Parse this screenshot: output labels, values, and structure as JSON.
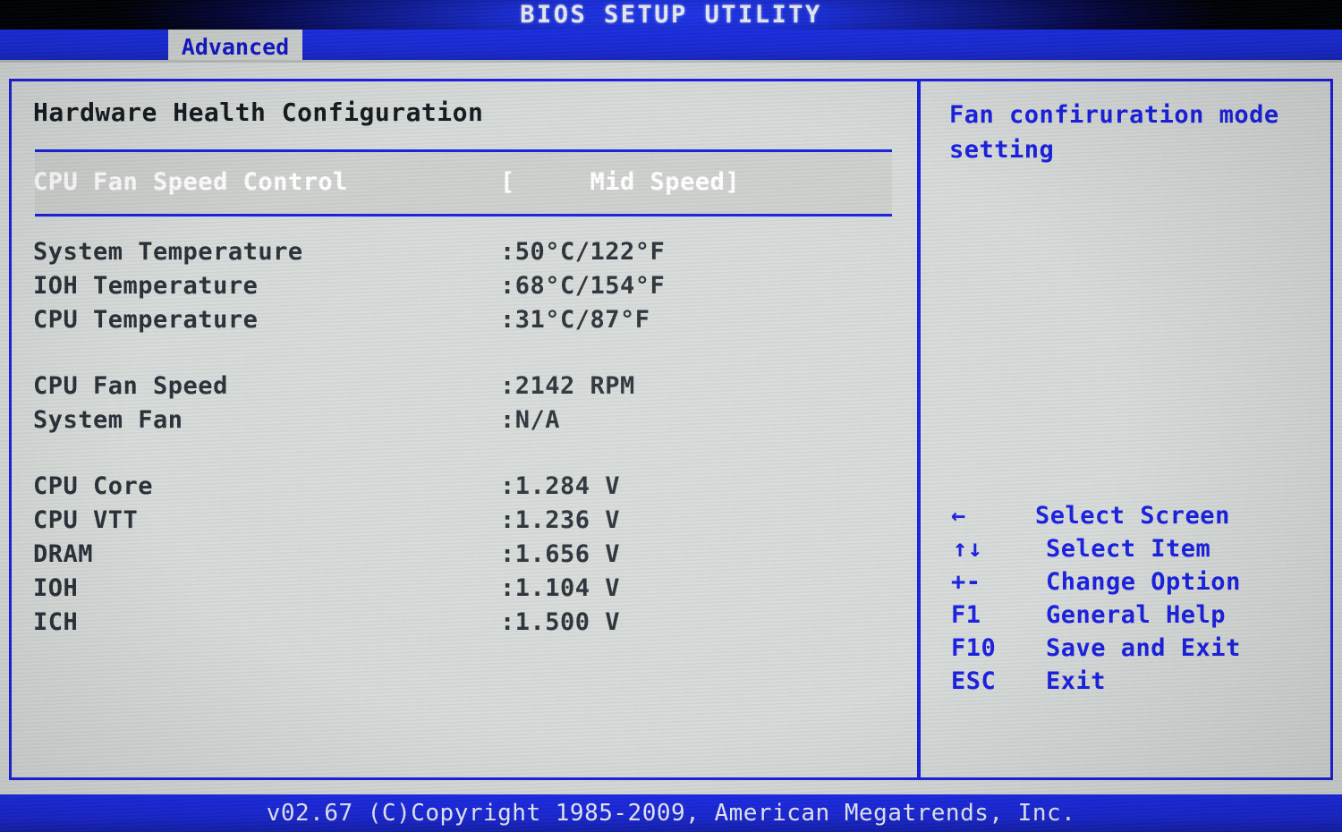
{
  "titlebar": {
    "title": "BIOS SETUP UTILITY"
  },
  "tabs": [
    {
      "label": "Advanced",
      "active": true
    }
  ],
  "main": {
    "section_title": "Hardware Health Configuration",
    "selected_row": {
      "label": "CPU Fan Speed Control",
      "value": "[     Mid Speed]"
    },
    "readings": [
      {
        "label": "System Temperature",
        "value": ":50°C/122°F"
      },
      {
        "label": "IOH Temperature",
        "value": ":68°C/154°F"
      },
      {
        "label": "CPU Temperature",
        "value": ":31°C/87°F"
      },
      {
        "label": "CPU Fan Speed",
        "value": ":2142 RPM"
      },
      {
        "label": "System Fan",
        "value": ":N/A"
      },
      {
        "label": "CPU Core",
        "value": ":1.284 V"
      },
      {
        "label": "CPU VTT",
        "value": ":1.236 V"
      },
      {
        "label": "DRAM",
        "value": ":1.656 V"
      },
      {
        "label": "IOH",
        "value": ":1.104 V"
      },
      {
        "label": "ICH",
        "value": ":1.500 V"
      }
    ]
  },
  "help": {
    "text": "Fan confiruration mode setting",
    "keys": [
      {
        "key": "←",
        "action": "Select Screen"
      },
      {
        "key": "↑↓",
        "action": "Select Item"
      },
      {
        "key": "+-",
        "action": "Change Option"
      },
      {
        "key": "F1",
        "action": "General Help"
      },
      {
        "key": "F10",
        "action": "Save and Exit"
      },
      {
        "key": "ESC",
        "action": "Exit"
      }
    ]
  },
  "footer": {
    "text": "v02.67 (C)Copyright 1985-2009, American Megatrends, Inc."
  },
  "colors": {
    "accent_blue": "#1a20e0",
    "panel_bg": "#d6dad9",
    "selected_text": "#ffffff",
    "reading_text": "#2a3038",
    "title_text": "#eef0f8"
  }
}
